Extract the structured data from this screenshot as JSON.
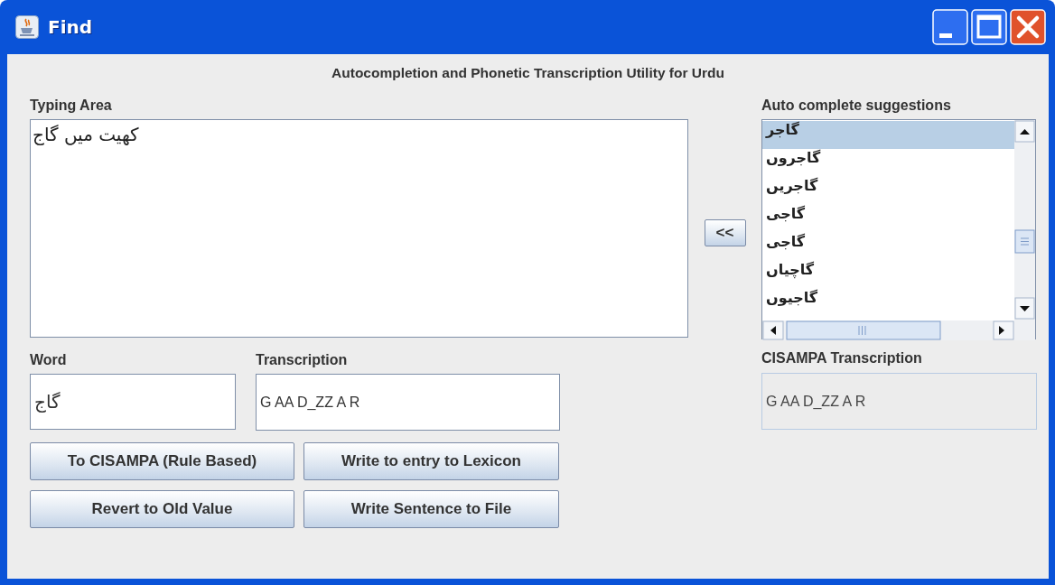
{
  "window": {
    "title": "Find"
  },
  "heading": "Autocompletion and Phonetic Transcription Utility for Urdu",
  "typing_area": {
    "label": "Typing Area",
    "value": "کھیت میں گاج"
  },
  "insert_button": "<<",
  "suggestions": {
    "label": "Auto complete suggestions",
    "items": [
      {
        "text": "گاجر",
        "selected": true
      },
      {
        "text": "گاجروں",
        "selected": false
      },
      {
        "text": "گاجریں",
        "selected": false
      },
      {
        "text": "گاجی",
        "selected": false
      },
      {
        "text": "گاجی",
        "selected": false
      },
      {
        "text": "گاچیاں",
        "selected": false
      },
      {
        "text": "گاجیوں",
        "selected": false
      }
    ]
  },
  "word": {
    "label": "Word",
    "value": "گاج"
  },
  "transcription": {
    "label": "Transcription",
    "value": "G AA D_ZZ A R"
  },
  "cisampa": {
    "label": "CISAMPA Transcription",
    "value": "G AA D_ZZ A R",
    "disabled": true
  },
  "cisampa_button": "To CISAMPA (Rule Based)",
  "lexicon_button": "Write to entry to Lexicon",
  "revert_button": "Revert to Old Value",
  "write_sentence_button": "Write Sentence to File"
}
